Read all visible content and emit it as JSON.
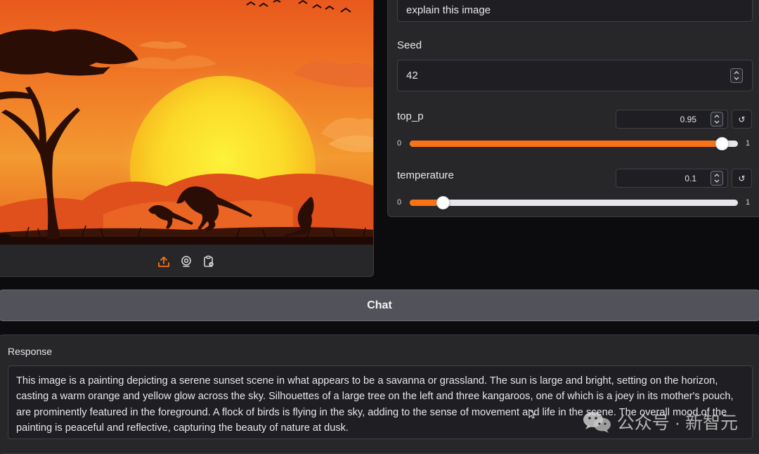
{
  "image_toolbar": {
    "icons": [
      "upload-icon",
      "webcam-icon",
      "clipboard-icon"
    ]
  },
  "prompt": {
    "value": "explain this image"
  },
  "seed": {
    "label": "Seed",
    "value": "42"
  },
  "top_p": {
    "label": "top_p",
    "value": "0.95",
    "min": "0",
    "max": "1",
    "level": 0.95
  },
  "temperature": {
    "label": "temperature",
    "value": "0.1",
    "min": "0",
    "max": "1",
    "level": 0.1
  },
  "reset_icon": "↺",
  "chat_button": {
    "label": "Chat"
  },
  "response": {
    "label": "Response",
    "text": "This image is a painting depicting a serene sunset scene in what appears to be a savanna or grassland. The sun is large and bright, setting on the horizon, casting a warm orange and yellow glow across the sky. Silhouettes of a large tree on the left and three kangaroos, one of which is a joey in its mother's pouch, are prominently featured in the foreground. A flock of birds is flying in the sky, adding to the sense of movement and life in the scene. The overall mood of the painting is peaceful and reflective, capturing the beauty of nature at dusk."
  },
  "watermark": {
    "text": "公众号 · 新智元"
  },
  "colors": {
    "accent": "#f97316",
    "panel": "#27272a",
    "background": "#0c0c0f"
  }
}
